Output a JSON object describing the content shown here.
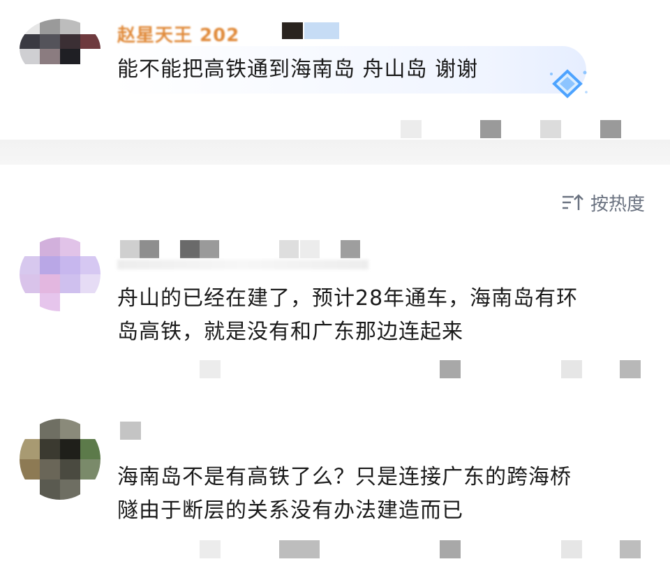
{
  "comments": [
    {
      "text": "能不能把高铁通到海南岛 舟山岛 谢谢",
      "username_fragment": "赵星天王 202"
    },
    {
      "text_line1": "舟山的已经在建了，预计28年通车，海南岛有环",
      "text_line2": "岛高铁，就是没有和广东那边连起来"
    },
    {
      "text_line1": "海南岛不是有高铁了么？只是连接广东的跨海桥",
      "text_line2": "隧由于断层的关系没有办法建造而已"
    }
  ],
  "sort": {
    "label": "按热度",
    "icon": "sort-icon"
  },
  "colors": {
    "text": "#1a1a1a",
    "sort_text": "#6a7280",
    "separator": "#f2f2f2",
    "badge": "#4da3ff"
  }
}
